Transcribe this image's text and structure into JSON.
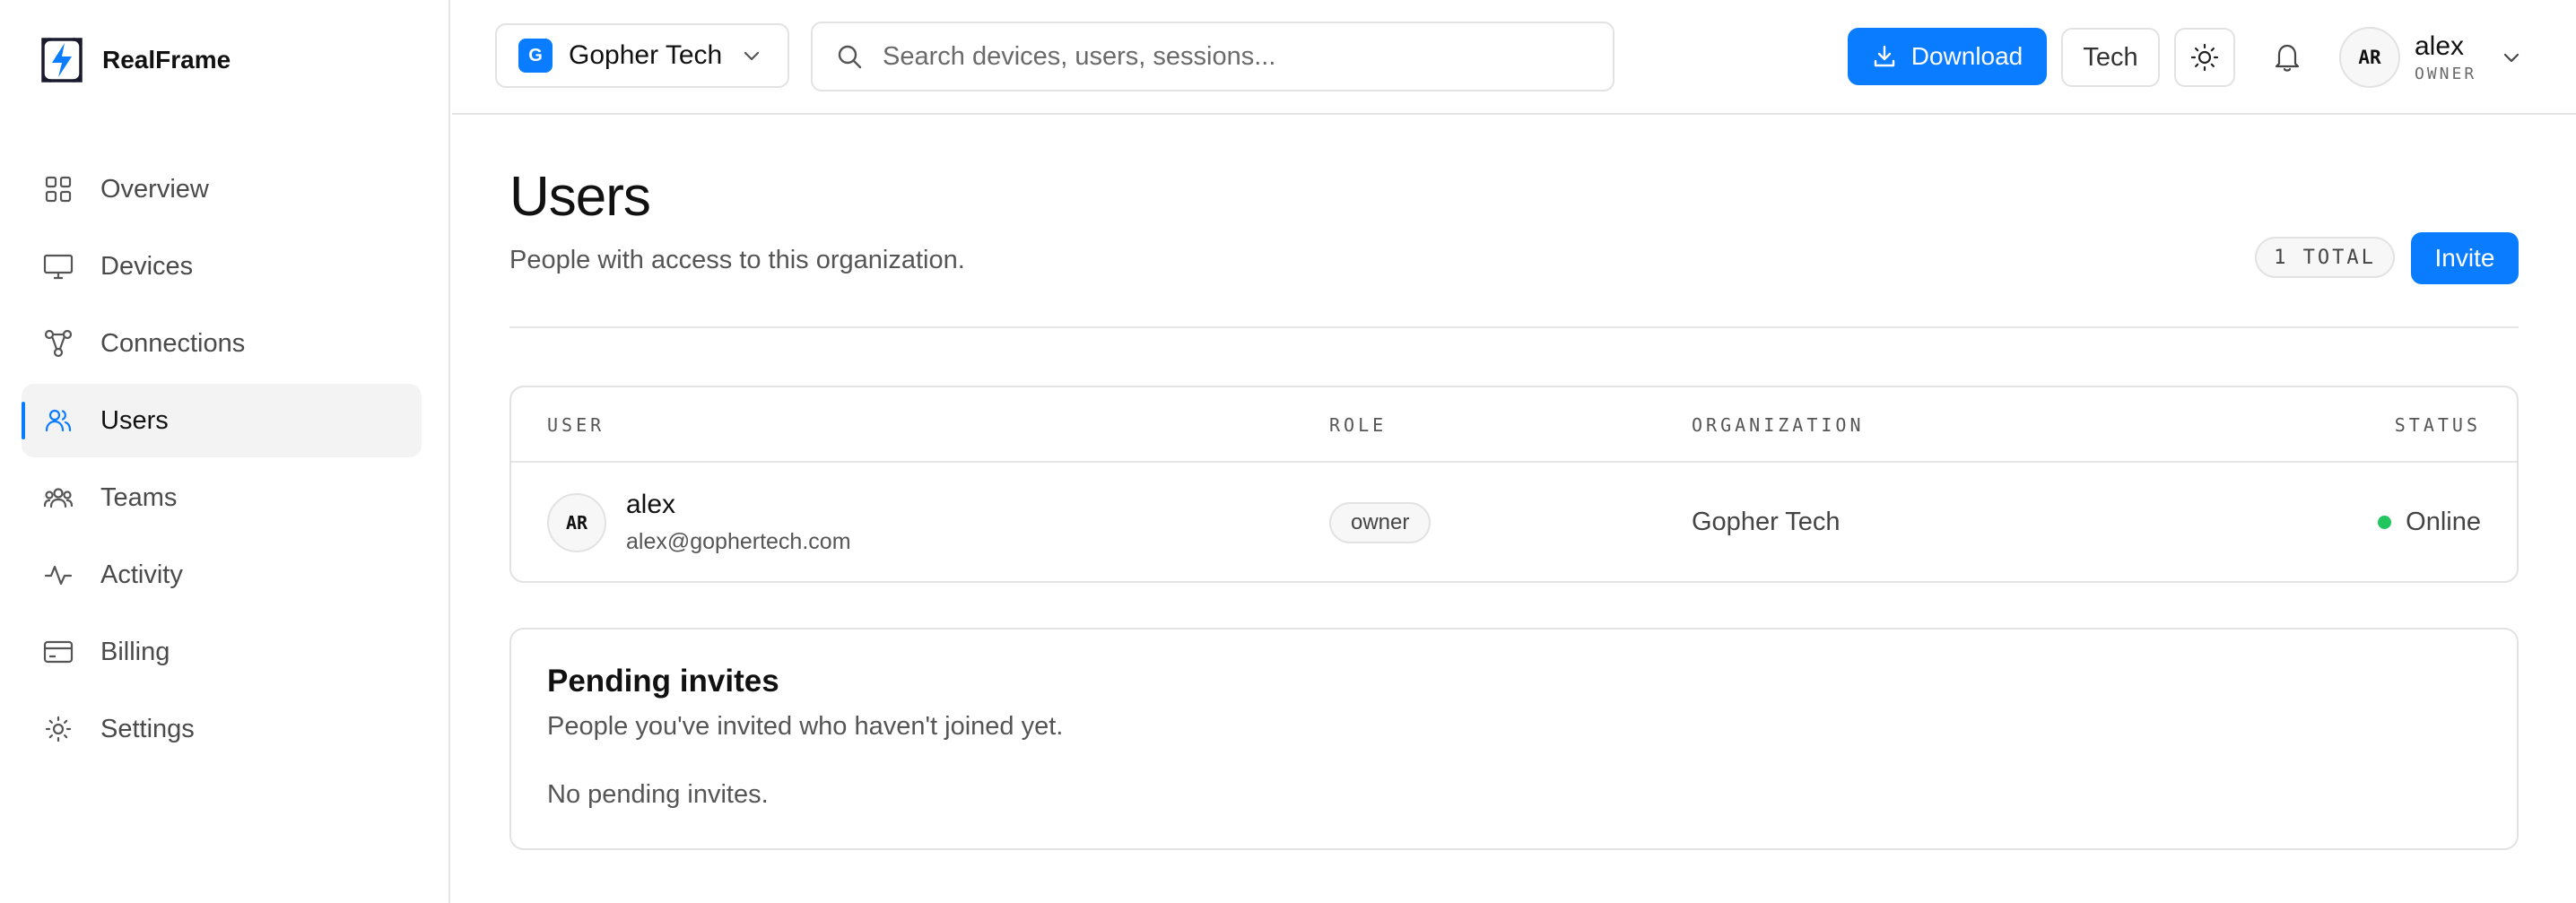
{
  "brand": {
    "name": "RealFrame"
  },
  "sidebar": {
    "items": [
      {
        "label": "Overview",
        "icon": "grid-icon"
      },
      {
        "label": "Devices",
        "icon": "monitor-icon"
      },
      {
        "label": "Connections",
        "icon": "connections-icon"
      },
      {
        "label": "Users",
        "icon": "users-icon",
        "active": true
      },
      {
        "label": "Teams",
        "icon": "team-icon"
      },
      {
        "label": "Activity",
        "icon": "activity-icon"
      },
      {
        "label": "Billing",
        "icon": "credit-card-icon"
      },
      {
        "label": "Settings",
        "icon": "gear-icon"
      }
    ]
  },
  "header": {
    "org": {
      "badge": "G",
      "name": "Gopher Tech"
    },
    "search": {
      "placeholder": "Search devices, users, sessions..."
    },
    "download_label": "Download",
    "tech_label": "Tech",
    "user": {
      "initials": "AR",
      "name": "alex",
      "role": "OWNER"
    }
  },
  "page": {
    "title": "Users",
    "subtitle": "People with access to this organization.",
    "total_badge": "1 TOTAL",
    "invite_label": "Invite"
  },
  "users_table": {
    "columns": [
      "USER",
      "ROLE",
      "ORGANIZATION",
      "STATUS"
    ],
    "rows": [
      {
        "initials": "AR",
        "name": "alex",
        "email": "alex@gophertech.com",
        "role": "owner",
        "organization": "Gopher Tech",
        "status": "Online"
      }
    ]
  },
  "pending_invites": {
    "title": "Pending invites",
    "subtitle": "People you've invited who haven't joined yet.",
    "empty_text": "No pending invites."
  },
  "colors": {
    "accent": "#0a7cff",
    "online": "#22c55e",
    "border": "#e2e2e2"
  }
}
